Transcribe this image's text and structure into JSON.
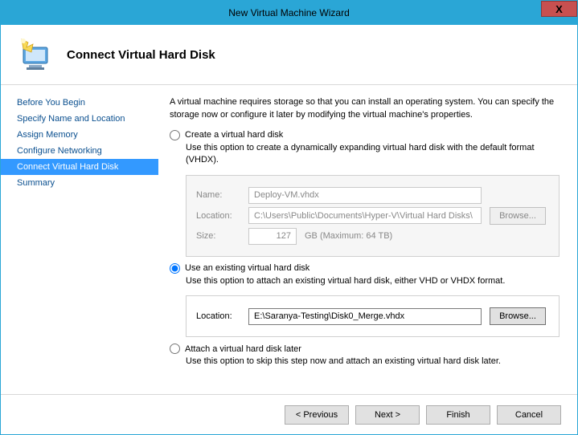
{
  "window": {
    "title": "New Virtual Machine Wizard",
    "close": "X"
  },
  "header": {
    "title": "Connect Virtual Hard Disk"
  },
  "sidebar": {
    "items": [
      {
        "label": "Before You Begin"
      },
      {
        "label": "Specify Name and Location"
      },
      {
        "label": "Assign Memory"
      },
      {
        "label": "Configure Networking"
      },
      {
        "label": "Connect Virtual Hard Disk"
      },
      {
        "label": "Summary"
      }
    ]
  },
  "content": {
    "intro": "A virtual machine requires storage so that you can install an operating system. You can specify the storage now or configure it later by modifying the virtual machine's properties.",
    "create": {
      "label": "Create a virtual hard disk",
      "desc": "Use this option to create a dynamically expanding virtual hard disk with the default format (VHDX).",
      "nameLabel": "Name:",
      "nameValue": "Deploy-VM.vhdx",
      "locationLabel": "Location:",
      "locationValue": "C:\\Users\\Public\\Documents\\Hyper-V\\Virtual Hard Disks\\",
      "sizeLabel": "Size:",
      "sizeValue": "127",
      "sizeSuffix": "GB (Maximum: 64 TB)",
      "browse": "Browse..."
    },
    "use": {
      "label": "Use an existing virtual hard disk",
      "desc": "Use this option to attach an existing virtual hard disk, either VHD or VHDX format.",
      "locationLabel": "Location:",
      "locationValue": "E:\\Saranya-Testing\\Disk0_Merge.vhdx",
      "browse": "Browse..."
    },
    "attach": {
      "label": "Attach a virtual hard disk later",
      "desc": "Use this option to skip this step now and attach an existing virtual hard disk later."
    }
  },
  "footer": {
    "previous": "< Previous",
    "next": "Next >",
    "finish": "Finish",
    "cancel": "Cancel"
  }
}
